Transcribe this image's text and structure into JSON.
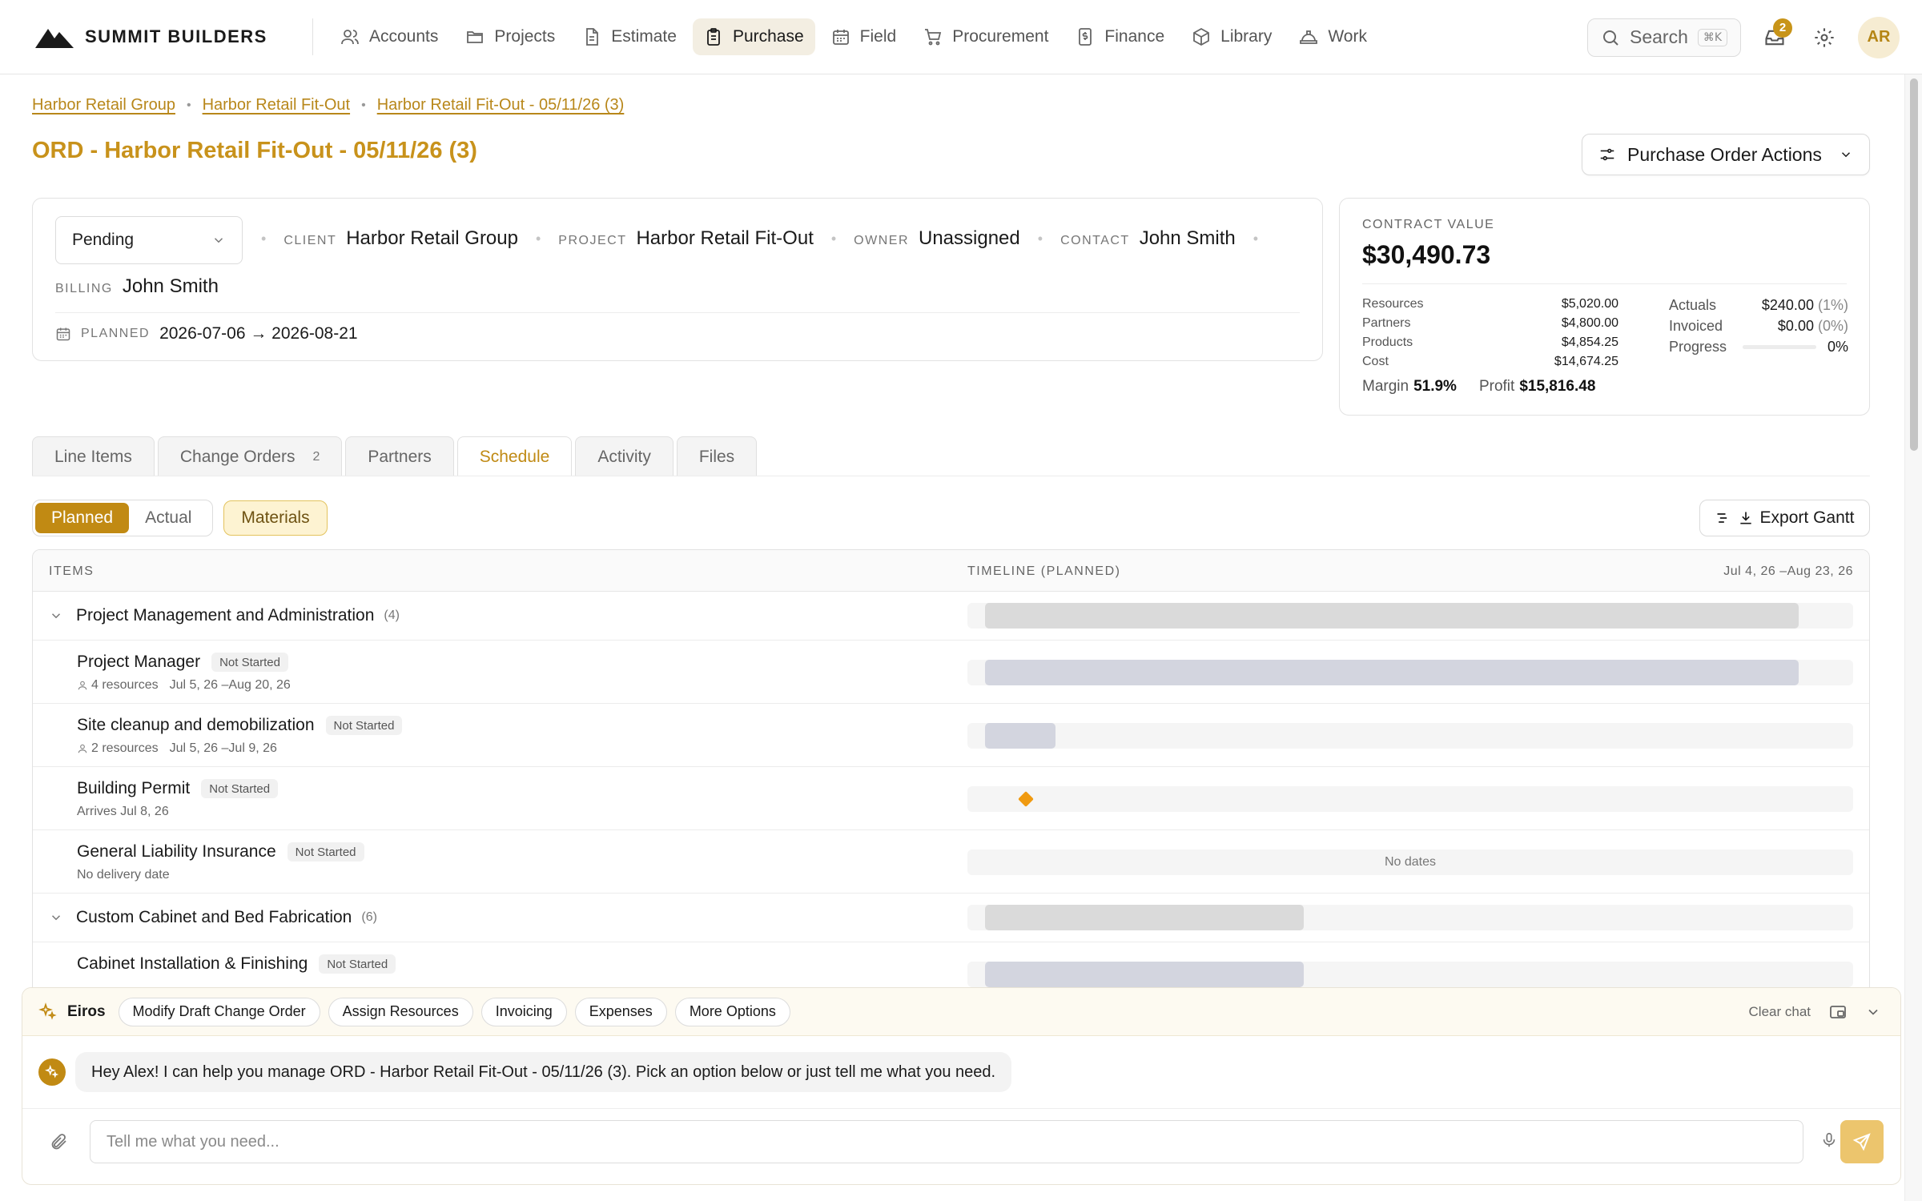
{
  "brand": {
    "name": "SUMMIT BUILDERS"
  },
  "nav": {
    "items": [
      {
        "label": "Accounts",
        "icon": "users-icon"
      },
      {
        "label": "Projects",
        "icon": "folder-icon"
      },
      {
        "label": "Estimate",
        "icon": "document-icon"
      },
      {
        "label": "Purchase",
        "icon": "clipboard-icon",
        "active": true
      },
      {
        "label": "Field",
        "icon": "calendar-icon"
      },
      {
        "label": "Procurement",
        "icon": "cart-icon"
      },
      {
        "label": "Finance",
        "icon": "dollar-file-icon"
      },
      {
        "label": "Library",
        "icon": "box-icon"
      },
      {
        "label": "Work",
        "icon": "hardhat-icon"
      }
    ],
    "search_placeholder": "Search",
    "search_shortcut": "⌘K",
    "notification_count": "2",
    "user_initials": "AR"
  },
  "breadcrumb": [
    "Harbor Retail Group",
    "Harbor Retail Fit-Out",
    "Harbor Retail Fit-Out - 05/11/26 (3)"
  ],
  "page": {
    "title": "ORD - Harbor Retail Fit-Out - 05/11/26 (3)",
    "actions_label": "Purchase Order Actions"
  },
  "info": {
    "status": "Pending",
    "client_label": "CLIENT",
    "client": "Harbor Retail Group",
    "project_label": "PROJECT",
    "project": "Harbor Retail Fit-Out",
    "owner_label": "OWNER",
    "owner": "Unassigned",
    "contact_label": "CONTACT",
    "contact": "John Smith",
    "billing_label": "BILLING",
    "billing": "John Smith",
    "planned_label": "PLANNED",
    "planned": "2026-07-06 → 2026-08-21"
  },
  "contract": {
    "label": "CONTRACT VALUE",
    "value": "$30,490.73",
    "breakdown": [
      {
        "label": "Resources",
        "value": "$5,020.00"
      },
      {
        "label": "Partners",
        "value": "$4,800.00"
      },
      {
        "label": "Products",
        "value": "$4,854.25"
      },
      {
        "label": "Cost",
        "value": "$14,674.25"
      }
    ],
    "actuals_label": "Actuals",
    "actuals": "$240.00",
    "actuals_pct": "(1%)",
    "invoiced_label": "Invoiced",
    "invoiced": "$0.00",
    "invoiced_pct": "(0%)",
    "progress_label": "Progress",
    "progress": "0%",
    "progress_fraction": 0,
    "margin_label": "Margin",
    "margin": "51.9%",
    "profit_label": "Profit",
    "profit": "$15,816.48"
  },
  "tabs": [
    {
      "label": "Line Items"
    },
    {
      "label": "Change Orders",
      "count": "2"
    },
    {
      "label": "Partners"
    },
    {
      "label": "Schedule",
      "active": true
    },
    {
      "label": "Activity"
    },
    {
      "label": "Files"
    }
  ],
  "schedule": {
    "planned_label": "Planned",
    "actual_label": "Actual",
    "materials_label": "Materials",
    "export_label": "Export Gantt",
    "col_items": "ITEMS",
    "col_timeline": "TIMELINE (PLANNED)",
    "range": "Jul 4, 26 –Aug 23, 26",
    "groups": [
      {
        "title": "Project Management and Administration",
        "count": "(4)",
        "bar": {
          "start": "Jul 5, 26",
          "end": "Aug 20, 26"
        },
        "items": [
          {
            "title": "Project Manager",
            "status": "Not Started",
            "resources": "4 resources",
            "dates": "Jul 5, 26 –Aug 20, 26"
          },
          {
            "title": "Site cleanup and demobilization",
            "status": "Not Started",
            "resources": "2 resources",
            "dates": "Jul 5, 26 –Jul 9, 26"
          },
          {
            "title": "Building Permit",
            "status": "Not Started",
            "note": "Arrives Jul 8, 26"
          },
          {
            "title": "General Liability Insurance",
            "status": "Not Started",
            "note": "No delivery date",
            "timeline_text": "No dates"
          }
        ]
      },
      {
        "title": "Custom Cabinet and Bed Fabrication",
        "count": "(6)",
        "items": [
          {
            "title": "Cabinet Installation & Finishing",
            "status": "Not Started"
          }
        ]
      }
    ]
  },
  "chat": {
    "assistant_name": "Eiros",
    "chips": [
      "Modify Draft Change Order",
      "Assign Resources",
      "Invoicing",
      "Expenses",
      "More Options"
    ],
    "clear_label": "Clear chat",
    "message": "Hey Alex! I can help you manage ORD - Harbor Retail Fit-Out - 05/11/26 (3). Pick an option below or just tell me what you need.",
    "input_placeholder": "Tell me what you need..."
  }
}
